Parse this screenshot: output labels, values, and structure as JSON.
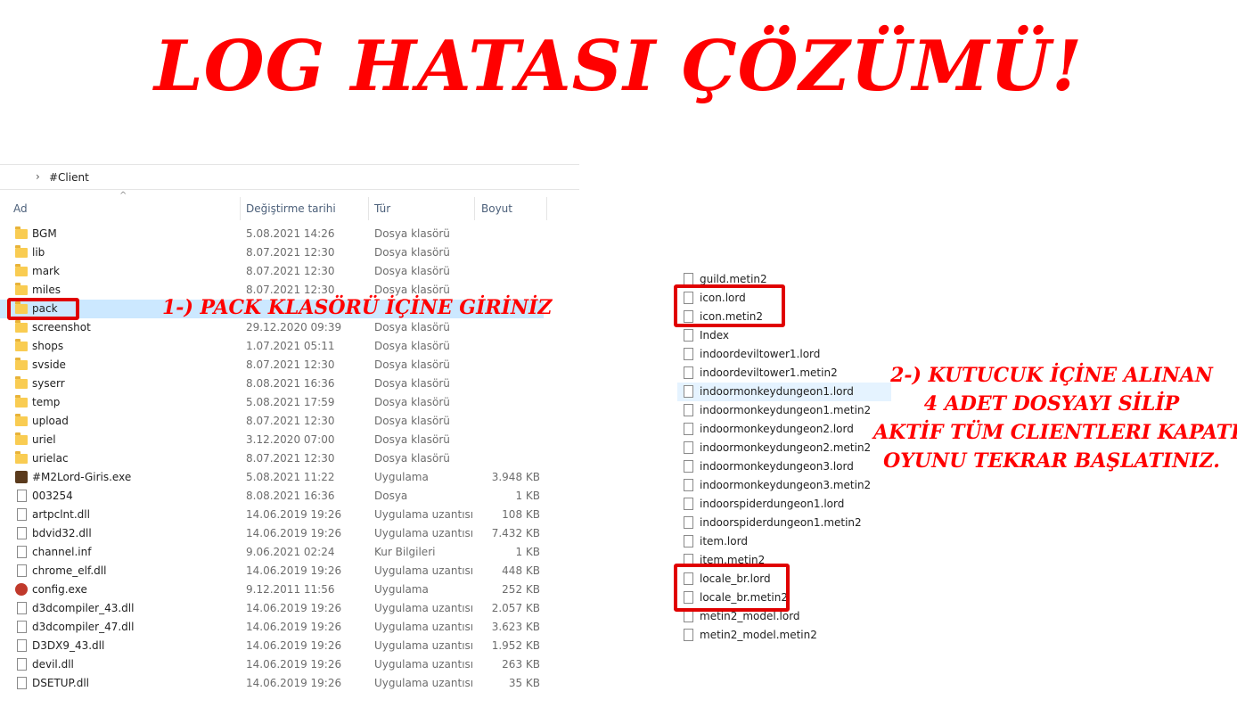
{
  "title": "LOG HATASI ÇÖZÜMÜ!",
  "explorer": {
    "address_path": "#Client",
    "columns": {
      "name": "Ad",
      "date": "Değiştirme tarihi",
      "type": "Tür",
      "size": "Boyut"
    },
    "rows": [
      {
        "name": "BGM",
        "date": "5.08.2021 14:26",
        "type": "Dosya klasörü",
        "size": "",
        "icon": "folder"
      },
      {
        "name": "lib",
        "date": "8.07.2021 12:30",
        "type": "Dosya klasörü",
        "size": "",
        "icon": "folder"
      },
      {
        "name": "mark",
        "date": "8.07.2021 12:30",
        "type": "Dosya klasörü",
        "size": "",
        "icon": "folder"
      },
      {
        "name": "miles",
        "date": "8.07.2021 12:30",
        "type": "Dosya klasörü",
        "size": "",
        "icon": "folder"
      },
      {
        "name": "pack",
        "date": "",
        "type": "",
        "size": "",
        "icon": "folder",
        "selected": true
      },
      {
        "name": "screenshot",
        "date": "29.12.2020 09:39",
        "type": "Dosya klasörü",
        "size": "",
        "icon": "folder"
      },
      {
        "name": "shops",
        "date": "1.07.2021 05:11",
        "type": "Dosya klasörü",
        "size": "",
        "icon": "folder"
      },
      {
        "name": "svside",
        "date": "8.07.2021 12:30",
        "type": "Dosya klasörü",
        "size": "",
        "icon": "folder"
      },
      {
        "name": "syserr",
        "date": "8.08.2021 16:36",
        "type": "Dosya klasörü",
        "size": "",
        "icon": "folder"
      },
      {
        "name": "temp",
        "date": "5.08.2021 17:59",
        "type": "Dosya klasörü",
        "size": "",
        "icon": "folder"
      },
      {
        "name": "upload",
        "date": "8.07.2021 12:30",
        "type": "Dosya klasörü",
        "size": "",
        "icon": "folder"
      },
      {
        "name": "uriel",
        "date": "3.12.2020 07:00",
        "type": "Dosya klasörü",
        "size": "",
        "icon": "folder"
      },
      {
        "name": "urielac",
        "date": "8.07.2021 12:30",
        "type": "Dosya klasörü",
        "size": "",
        "icon": "folder"
      },
      {
        "name": "#M2Lord-Giris.exe",
        "date": "5.08.2021 11:22",
        "type": "Uygulama",
        "size": "3.948 KB",
        "icon": "exe"
      },
      {
        "name": "003254",
        "date": "8.08.2021 16:36",
        "type": "Dosya",
        "size": "1 KB",
        "icon": "file"
      },
      {
        "name": "artpclnt.dll",
        "date": "14.06.2019 19:26",
        "type": "Uygulama uzantısı",
        "size": "108 KB",
        "icon": "file"
      },
      {
        "name": "bdvid32.dll",
        "date": "14.06.2019 19:26",
        "type": "Uygulama uzantısı",
        "size": "7.432 KB",
        "icon": "file"
      },
      {
        "name": "channel.inf",
        "date": "9.06.2021 02:24",
        "type": "Kur Bilgileri",
        "size": "1 KB",
        "icon": "file"
      },
      {
        "name": "chrome_elf.dll",
        "date": "14.06.2019 19:26",
        "type": "Uygulama uzantısı",
        "size": "448 KB",
        "icon": "file"
      },
      {
        "name": "config.exe",
        "date": "9.12.2011 11:56",
        "type": "Uygulama",
        "size": "252 KB",
        "icon": "config"
      },
      {
        "name": "d3dcompiler_43.dll",
        "date": "14.06.2019 19:26",
        "type": "Uygulama uzantısı",
        "size": "2.057 KB",
        "icon": "file"
      },
      {
        "name": "d3dcompiler_47.dll",
        "date": "14.06.2019 19:26",
        "type": "Uygulama uzantısı",
        "size": "3.623 KB",
        "icon": "file"
      },
      {
        "name": "D3DX9_43.dll",
        "date": "14.06.2019 19:26",
        "type": "Uygulama uzantısı",
        "size": "1.952 KB",
        "icon": "file"
      },
      {
        "name": "devil.dll",
        "date": "14.06.2019 19:26",
        "type": "Uygulama uzantısı",
        "size": "263 KB",
        "icon": "file"
      },
      {
        "name": "DSETUP.dll",
        "date": "14.06.2019 19:26",
        "type": "Uygulama uzantısı",
        "size": "35 KB",
        "icon": "file"
      }
    ]
  },
  "annotation_1": "1-) PACK KLASÖRÜ İÇİNE GİRİNİZ",
  "annotation_2": [
    "2-) KUTUCUK İÇİNE ALINAN",
    "4 ADET DOSYAYI SİLİP",
    "AKTİF TÜM CLIENTLERI KAPATIP",
    "OYUNU TEKRAR BAŞLATINIZ."
  ],
  "pack_files": [
    {
      "name": "guild.metin2"
    },
    {
      "name": "icon.lord"
    },
    {
      "name": "icon.metin2"
    },
    {
      "name": "Index"
    },
    {
      "name": "indoordeviltower1.lord"
    },
    {
      "name": "indoordeviltower1.metin2"
    },
    {
      "name": "indoormonkeydungeon1.lord",
      "highlighted": true
    },
    {
      "name": "indoormonkeydungeon1.metin2"
    },
    {
      "name": "indoormonkeydungeon2.lord"
    },
    {
      "name": "indoormonkeydungeon2.metin2"
    },
    {
      "name": "indoormonkeydungeon3.lord"
    },
    {
      "name": "indoormonkeydungeon3.metin2"
    },
    {
      "name": "indoorspiderdungeon1.lord"
    },
    {
      "name": "indoorspiderdungeon1.metin2"
    },
    {
      "name": "item.lord"
    },
    {
      "name": "item.metin2"
    },
    {
      "name": "locale_br.lord"
    },
    {
      "name": "locale_br.metin2"
    },
    {
      "name": "metin2_model.lord"
    },
    {
      "name": "metin2_model.metin2"
    }
  ],
  "colors": {
    "annotation": "#ff0000",
    "highlight_box": "#e00000",
    "selection": "#cce8ff"
  }
}
